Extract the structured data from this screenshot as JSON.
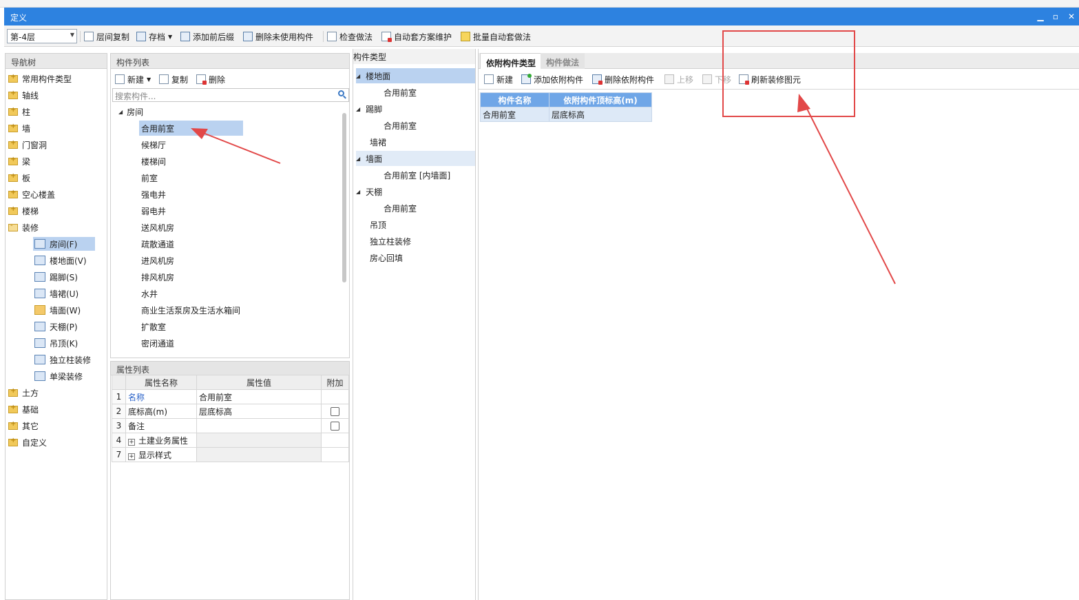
{
  "window": {
    "title": "定义",
    "minimize": "▁",
    "maximize": "▫",
    "close": "✕"
  },
  "toolbar": {
    "floor": "第-4层",
    "buttons": [
      "层间复制",
      "存档",
      "添加前后缀",
      "删除未使用构件",
      "检查做法",
      "自动套方案维护",
      "批量自动套做法"
    ]
  },
  "nav": {
    "header": "导航树",
    "items": [
      "常用构件类型",
      "轴线",
      "柱",
      "墙",
      "门窗洞",
      "梁",
      "板",
      "空心楼盖",
      "楼梯",
      "装修"
    ],
    "sub_items": [
      "房间(F)",
      "楼地面(V)",
      "踢脚(S)",
      "墙裙(U)",
      "墙面(W)",
      "天棚(P)",
      "吊顶(K)",
      "独立柱装修",
      "单梁装修"
    ],
    "items_after": [
      "土方",
      "基础",
      "其它",
      "自定义"
    ]
  },
  "component_list": {
    "header": "构件列表",
    "new_label": "新建",
    "copy_label": "复制",
    "delete_label": "删除",
    "search_placeholder": "搜索构件...",
    "root": "房间",
    "items": [
      "合用前室",
      "候梯厅",
      "楼梯间",
      "前室",
      "强电井",
      "弱电井",
      "送风机房",
      "疏散通道",
      "进风机房",
      "排风机房",
      "水井",
      "商业生活泵房及生活水箱间",
      "扩散室",
      "密闭通道"
    ]
  },
  "properties": {
    "header": "属性列表",
    "columns": [
      "属性名称",
      "属性值",
      "附加"
    ],
    "rows": [
      {
        "num": "1",
        "name": "名称",
        "value": "合用前室"
      },
      {
        "num": "2",
        "name": "底标高(m)",
        "value": "层底标高"
      },
      {
        "num": "3",
        "name": "备注",
        "value": ""
      },
      {
        "num": "4",
        "name": "土建业务属性",
        "value": ""
      },
      {
        "num": "7",
        "name": "显示样式",
        "value": ""
      }
    ]
  },
  "component_types": {
    "header": "构件类型",
    "items": [
      "楼地面",
      "合用前室",
      "踢脚",
      "合用前室",
      "墙裙",
      "墙面",
      "合用前室 [内墙面]",
      "天棚",
      "合用前室",
      "吊顶",
      "独立柱装修",
      "房心回填"
    ]
  },
  "right": {
    "tabs": [
      "依附构件类型",
      "构件做法"
    ],
    "toolbar": [
      "新建",
      "添加依附构件",
      "删除依附构件",
      "上移",
      "下移",
      "刷新装修图元"
    ],
    "table_headers": [
      "构件名称",
      "依附构件顶标高(m)"
    ],
    "table_rows": [
      {
        "name": "合用前室",
        "value": "层底标高"
      }
    ]
  },
  "colors": {
    "titlebar": "#2d82e0",
    "selection": "#bad2f0",
    "annotation": "#e24848"
  }
}
